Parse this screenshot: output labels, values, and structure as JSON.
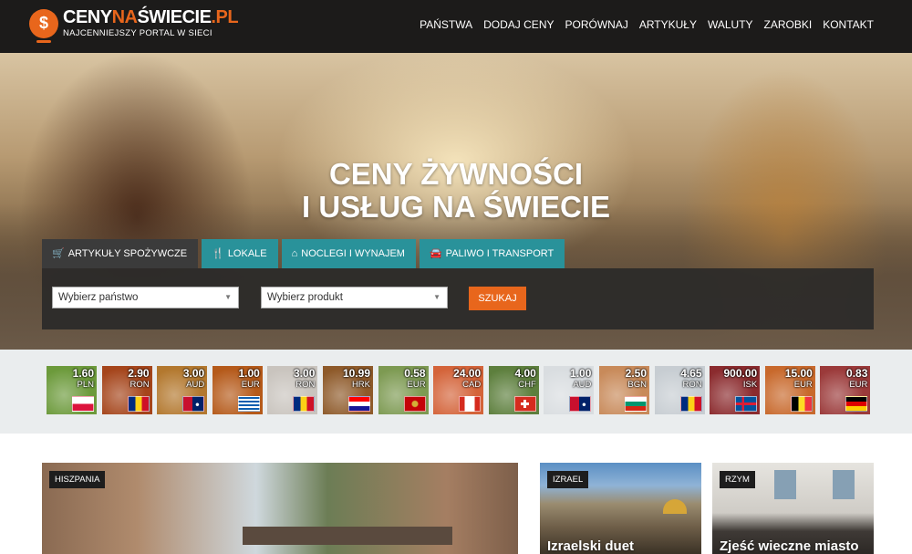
{
  "site": {
    "brand_ceny": "CENY",
    "brand_na": "NA",
    "brand_swiecie": "ŚWIECIE",
    "brand_pl": ".PL",
    "tagline": "NAJCENNIEJSZY PORTAL W SIECI",
    "logo_symbol": "$"
  },
  "nav": [
    "PAŃSTWA",
    "DODAJ CENY",
    "PORÓWNAJ",
    "ARTYKUŁY",
    "WALUTY",
    "ZAROBKI",
    "KONTAKT"
  ],
  "hero": {
    "line1": "CENY ŻYWNOŚCI",
    "line2": "I USŁUG NA ŚWIECIE"
  },
  "tabs": [
    {
      "label": "ARTYKUŁY SPOŻYWCZE",
      "icon": "cart-icon",
      "glyph": "🛒"
    },
    {
      "label": "LOKALE",
      "icon": "fork-knife-icon",
      "glyph": "🍴"
    },
    {
      "label": "NOCLEGI I WYNAJEM",
      "icon": "home-icon",
      "glyph": "⌂"
    },
    {
      "label": "PALIWO I TRANSPORT",
      "icon": "car-icon",
      "glyph": "🚘"
    }
  ],
  "search": {
    "country_placeholder": "Wybierz państwo",
    "product_placeholder": "Wybierz produkt",
    "button": "SZUKAJ"
  },
  "prices": [
    {
      "value": "1.60",
      "currency": "PLN",
      "bg": "#6c9a3b",
      "flag": "pl"
    },
    {
      "value": "2.90",
      "currency": "RON",
      "bg": "#a5451b",
      "flag": "ro"
    },
    {
      "value": "3.00",
      "currency": "AUD",
      "bg": "#b3782e",
      "flag": "au"
    },
    {
      "value": "1.00",
      "currency": "EUR",
      "bg": "#b55a1a",
      "flag": "gr"
    },
    {
      "value": "3.00",
      "currency": "RON",
      "bg": "#c9c4be",
      "flag": "ro"
    },
    {
      "value": "10.99",
      "currency": "HRK",
      "bg": "#8e5a2a",
      "flag": "hr"
    },
    {
      "value": "0.58",
      "currency": "EUR",
      "bg": "#7d9a52",
      "flag": "me"
    },
    {
      "value": "24.00",
      "currency": "CAD",
      "bg": "#d4643a",
      "flag": "ca"
    },
    {
      "value": "4.00",
      "currency": "CHF",
      "bg": "#5d7f3d",
      "flag": "ch"
    },
    {
      "value": "1.00",
      "currency": "AUD",
      "bg": "#d9dde0",
      "flag": "au"
    },
    {
      "value": "2.50",
      "currency": "BGN",
      "bg": "#c88a5a",
      "flag": "bg"
    },
    {
      "value": "4.65",
      "currency": "RON",
      "bg": "#c7cdd2",
      "flag": "ro"
    },
    {
      "value": "900.00",
      "currency": "ISK",
      "bg": "#8b2b2e",
      "flag": "is"
    },
    {
      "value": "15.00",
      "currency": "EUR",
      "bg": "#c8692c",
      "flag": "be"
    },
    {
      "value": "0.83",
      "currency": "EUR",
      "bg": "#9b3a3a",
      "flag": "de"
    }
  ],
  "articles": [
    {
      "tag": "HISZPANIA",
      "title": ""
    },
    {
      "tag": "IZRAEL",
      "title": "Izraelski duet"
    },
    {
      "tag": "RZYM",
      "title": "Zjeść wieczne miasto"
    }
  ]
}
